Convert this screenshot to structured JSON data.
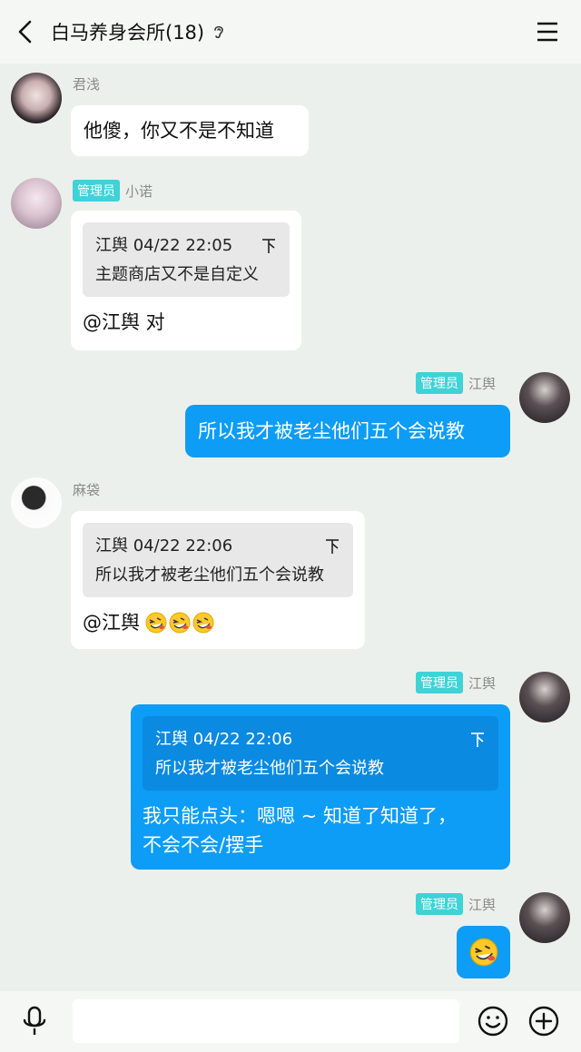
{
  "header": {
    "title": "白马养身会所(18)"
  },
  "messages": [
    {
      "sender": "君浅",
      "text": "他傻，你又不是不知道"
    },
    {
      "badge": "管理员",
      "sender": "小诺",
      "quote_head": "江舆 04/22 22:05",
      "quote_text": "主题商店又不是自定义",
      "text": "@江舆 对"
    },
    {
      "badge": "管理员",
      "sender": "江舆",
      "text": "所以我才被老尘他们五个会说教"
    },
    {
      "sender": "麻袋",
      "quote_head": "江舆 04/22 22:06",
      "quote_text": "所以我才被老尘他们五个会说教",
      "text": "@江舆"
    },
    {
      "badge": "管理员",
      "sender": "江舆",
      "quote_head": "江舆 04/22 22:06",
      "quote_text": "所以我才被老尘他们五个会说教",
      "text_line1": "我只能点头：嗯嗯 ~ 知道了知道了，",
      "text_line2": "不会不会/摆手"
    },
    {
      "badge": "管理员",
      "sender": "江舆"
    }
  ],
  "colors": {
    "background": "#ecf0ec",
    "outgoing_bubble": "#0d9cf6",
    "admin_badge": "#3fd2d6"
  },
  "icons": {
    "back": "chevron-left-icon",
    "ear": "ear-icon",
    "menu": "hamburger-menu-icon",
    "pin": "pin-top-icon",
    "emoji": "laughing-tongue-emoji",
    "mic": "microphone-icon",
    "smile": "smiley-icon",
    "plus": "plus-circle-icon"
  }
}
